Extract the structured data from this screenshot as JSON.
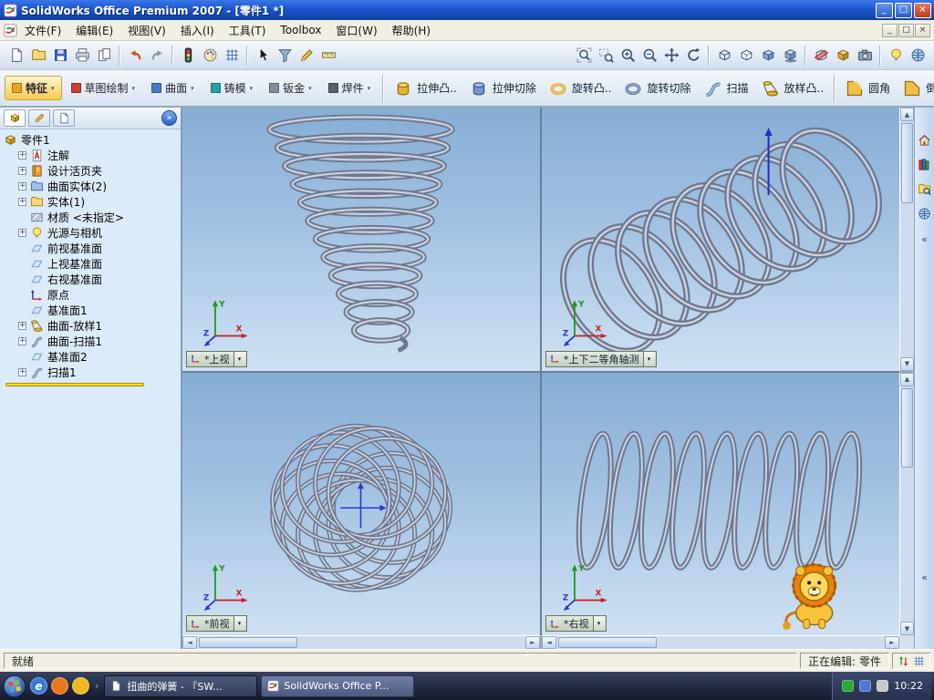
{
  "glyphs": {
    "dropdown": "▾",
    "up": "▲",
    "down": "▼",
    "left": "◄",
    "right": "►",
    "chevrons": "«",
    "more": "»",
    "expand": "+",
    "minimize": "_",
    "restore": "□",
    "close": "×",
    "quick_arrow": "›"
  },
  "window": {
    "title": "SolidWorks Office Premium 2007 - [零件1 *]"
  },
  "menubar": {
    "items": [
      "文件(F)",
      "编辑(E)",
      "视图(V)",
      "插入(I)",
      "工具(T)",
      "Toolbox",
      "窗口(W)",
      "帮助(H)"
    ]
  },
  "toolbar_main": {
    "items": [
      {
        "name": "new-document",
        "sym": "page"
      },
      {
        "name": "open-document",
        "sym": "folder"
      },
      {
        "name": "save",
        "sym": "floppy"
      },
      {
        "name": "print",
        "sym": "printer"
      },
      {
        "name": "print-preview",
        "sym": "page2"
      },
      {
        "sep": true
      },
      {
        "name": "undo",
        "sym": "undo"
      },
      {
        "name": "redo",
        "sym": "redo"
      },
      {
        "sep": true
      },
      {
        "name": "rebuild",
        "sym": "traffic"
      },
      {
        "name": "edit-color",
        "sym": "palette"
      },
      {
        "name": "textures",
        "sym": "grid"
      },
      {
        "sep": true
      },
      {
        "name": "select",
        "sym": "arrow"
      },
      {
        "name": "selection-filter",
        "sym": "funnel"
      },
      {
        "name": "sketch",
        "sym": "pencil"
      },
      {
        "name": "smart-dimension",
        "sym": "ruler"
      },
      {
        "spacer": true
      },
      {
        "name": "zoom-to-fit",
        "sym": "magfit"
      },
      {
        "name": "zoom-to-area",
        "sym": "magarea"
      },
      {
        "name": "zoom-in-out",
        "sym": "magplus"
      },
      {
        "name": "zoom-to-selection",
        "sym": "magminus"
      },
      {
        "name": "pan",
        "sym": "pan"
      },
      {
        "name": "rotate-view",
        "sym": "rotate"
      },
      {
        "sep": true
      },
      {
        "name": "wireframe",
        "sym": "cubewire"
      },
      {
        "name": "hidden-lines-visible",
        "sym": "cubehidden"
      },
      {
        "name": "shaded-with-edges",
        "sym": "cubeshaded"
      },
      {
        "name": "shadows-in-shaded-mode",
        "sym": "cubeshadow"
      },
      {
        "sep": true
      },
      {
        "name": "section-view",
        "sym": "section"
      },
      {
        "name": "view-orientation",
        "sym": "cubegold"
      },
      {
        "name": "camera-views",
        "sym": "camera"
      },
      {
        "sep": true
      },
      {
        "name": "lighting",
        "sym": "bulb"
      },
      {
        "name": "standard-views",
        "sym": "globe"
      }
    ]
  },
  "command_manager": {
    "tabs": [
      {
        "name": "tab-features",
        "label": "特征",
        "color": "#e8a41c",
        "active": true
      },
      {
        "name": "tab-sketch",
        "label": "草图绘制",
        "color": "#c84030"
      },
      {
        "name": "tab-surfaces",
        "label": "曲面",
        "color": "#4878c8"
      },
      {
        "name": "tab-molds",
        "label": "铸模",
        "color": "#28a0a0"
      },
      {
        "name": "tab-sheet-metal",
        "label": "钣金",
        "color": "#8090a0"
      },
      {
        "name": "tab-weldments",
        "label": "焊件",
        "color": "#586068"
      }
    ],
    "buttons": [
      {
        "name": "extruded-boss-button",
        "label": "拉伸凸..",
        "sym": "boss"
      },
      {
        "name": "extruded-cut-button",
        "label": "拉伸切除",
        "sym": "cut"
      },
      {
        "name": "revolved-boss-button",
        "label": "旋转凸..",
        "sym": "revolve"
      },
      {
        "name": "revolved-cut-button",
        "label": "旋转切除",
        "sym": "revcut"
      },
      {
        "name": "sweep-button",
        "label": "扫描",
        "sym": "sweepS"
      },
      {
        "name": "loft-button",
        "label": "放样凸..",
        "sym": "loft"
      },
      {
        "sep": true
      },
      {
        "name": "fillet-button",
        "label": "圆角",
        "sym": "fillet"
      },
      {
        "name": "chamfer-button",
        "label": "倒角",
        "sym": "chamfer"
      }
    ]
  },
  "feature_tree": {
    "root": {
      "label": "零件1"
    },
    "items": [
      {
        "label": "注解",
        "sym": "annA",
        "exp": true
      },
      {
        "label": "设计活页夹",
        "sym": "binder",
        "exp": true
      },
      {
        "label": "曲面实体(2)",
        "sym": "folderblue",
        "exp": true
      },
      {
        "label": "实体(1)",
        "sym": "folder",
        "exp": true
      },
      {
        "label": "材质 <未指定>",
        "sym": "material"
      },
      {
        "label": "光源与相机",
        "sym": "bulb",
        "exp": true
      },
      {
        "label": "前视基准面",
        "sym": "plane"
      },
      {
        "label": "上视基准面",
        "sym": "plane"
      },
      {
        "label": "右视基准面",
        "sym": "plane"
      },
      {
        "label": "原点",
        "sym": "origin"
      },
      {
        "label": "基准面1",
        "sym": "plane"
      },
      {
        "label": "曲面-放样1",
        "sym": "loft",
        "exp": true
      },
      {
        "label": "曲面-扫描1",
        "sym": "sweepS",
        "exp": true
      },
      {
        "label": "基准面2",
        "sym": "plane"
      },
      {
        "label": "扫描1",
        "sym": "sweepS",
        "exp": true
      }
    ]
  },
  "viewports": [
    {
      "name": "viewport-top-left",
      "label": "*上视"
    },
    {
      "name": "viewport-top-right",
      "label": "*上下二等角轴测"
    },
    {
      "name": "viewport-bottom-left",
      "label": "*前视"
    },
    {
      "name": "viewport-bottom-right",
      "label": "*右视"
    }
  ],
  "triad": {
    "x": "X",
    "y": "Y",
    "z": "Z"
  },
  "taskpane": {
    "icons": [
      {
        "name": "solidworks-resources",
        "sym": "house"
      },
      {
        "name": "design-library",
        "sym": "books"
      },
      {
        "name": "file-explorer",
        "sym": "foldermag"
      },
      {
        "name": "search",
        "sym": "globe"
      }
    ]
  },
  "status": {
    "ready": "就绪",
    "editing": "正在编辑: 零件"
  },
  "taskbar": {
    "quick_launch": [
      {
        "name": "internet-quick-launch",
        "color": "#3a7ad8",
        "glyph": "e"
      },
      {
        "name": "firefox-quick-launch",
        "color": "#e87818",
        "glyph": ""
      },
      {
        "name": "wangwang-quick-launch",
        "color": "#f0b820",
        "glyph": ""
      }
    ],
    "tasks": [
      {
        "name": "task-browser",
        "label": "扭曲的弹簧 - 『SW...",
        "sym": "page"
      },
      {
        "name": "task-solidworks",
        "label": "SolidWorks Office P...",
        "sym": "swlogo",
        "active": true
      }
    ],
    "tray": [
      {
        "name": "tray-icon-1",
        "color": "#2aa838"
      },
      {
        "name": "tray-icon-2",
        "color": "#4a7ad0"
      },
      {
        "name": "tray-icon-3",
        "color": "#c8c8c8"
      }
    ],
    "time": "10:22"
  }
}
